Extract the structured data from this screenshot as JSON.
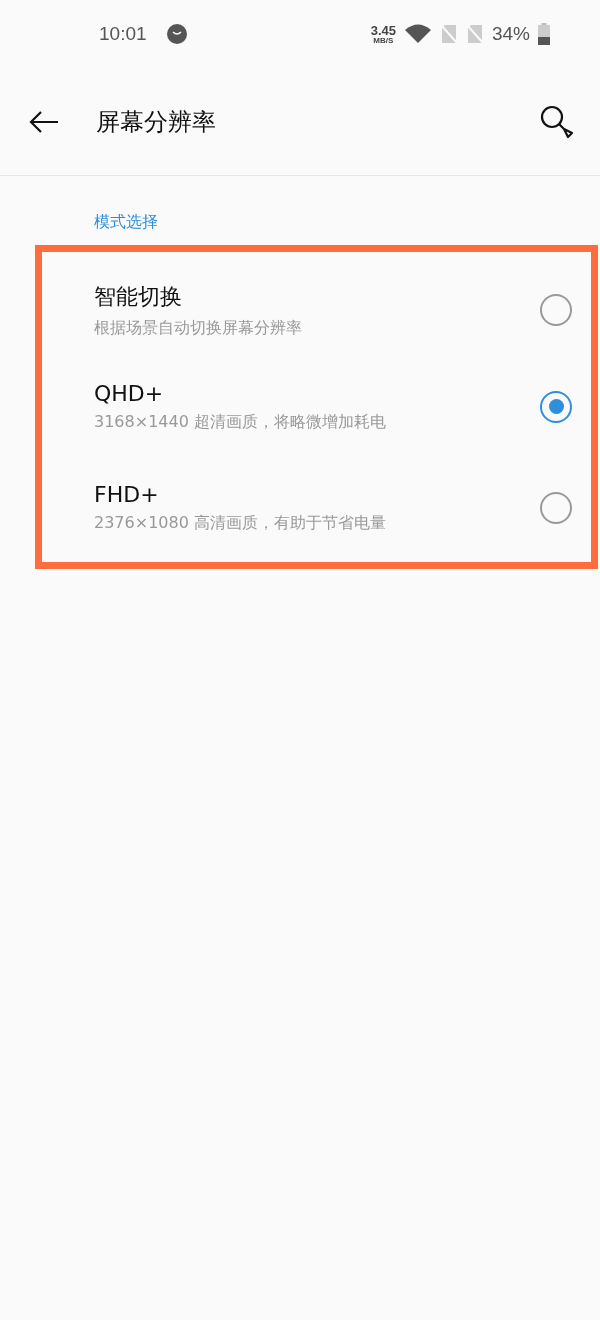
{
  "status_bar": {
    "time": "10:01",
    "speed_value": "3.45",
    "speed_unit": "MB/S",
    "battery": "34%"
  },
  "header": {
    "title": "屏幕分辨率"
  },
  "section": {
    "label": "模式选择",
    "highlighted": true,
    "options": [
      {
        "title": "智能切换",
        "subtitle": "根据场景自动切换屏幕分辨率",
        "selected": false
      },
      {
        "title": "QHD+",
        "subtitle": "3168×1440 超清画质，将略微增加耗电",
        "selected": true
      },
      {
        "title": "FHD+",
        "subtitle": "2376×1080 高清画质，有助于节省电量",
        "selected": false
      }
    ]
  }
}
